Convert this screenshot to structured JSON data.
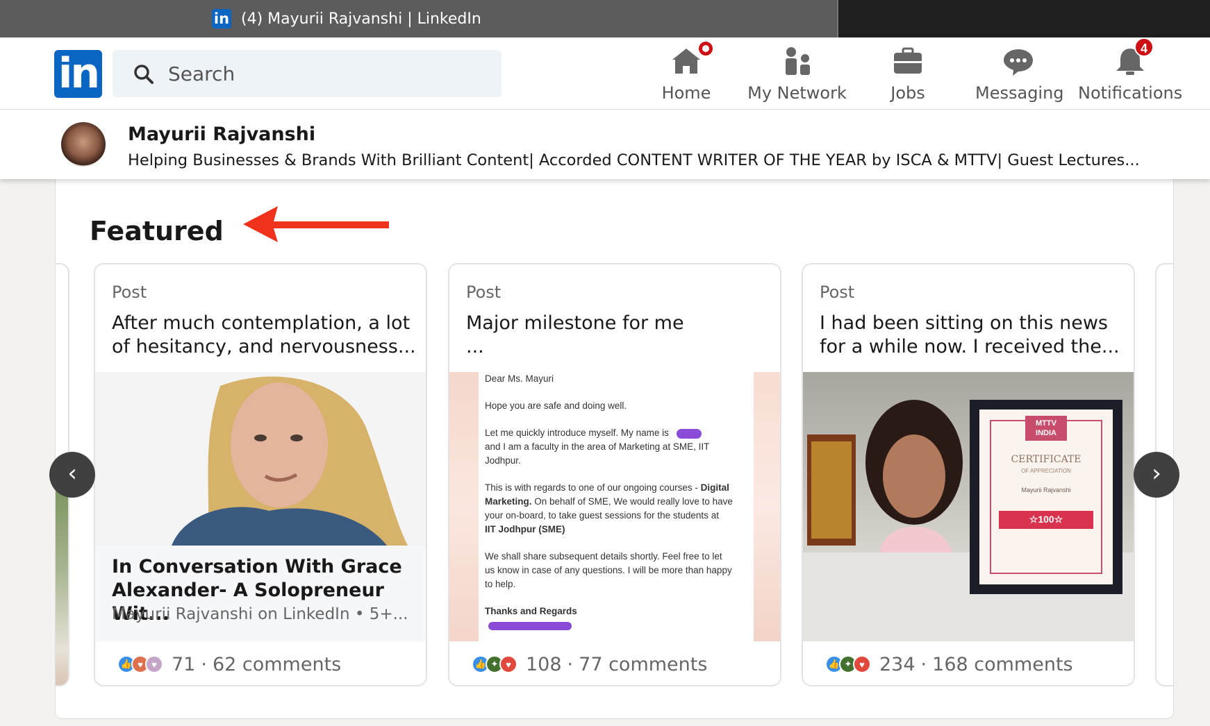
{
  "browser": {
    "tab_title": "(4) Mayurii Rajvanshi | LinkedIn",
    "favicon_text": "in"
  },
  "nav": {
    "logo_text": "in",
    "search_placeholder": "Search",
    "items": [
      {
        "label": "Home",
        "icon": "home-icon",
        "badge": ""
      },
      {
        "label": "My Network",
        "icon": "network-icon",
        "badge": ""
      },
      {
        "label": "Jobs",
        "icon": "briefcase-icon",
        "badge": ""
      },
      {
        "label": "Messaging",
        "icon": "chat-bubble-icon",
        "badge": ""
      },
      {
        "label": "Notifications",
        "icon": "bell-icon",
        "badge": "4"
      }
    ]
  },
  "profile": {
    "name": "Mayurii Rajvanshi",
    "headline": "Helping Businesses & Brands With Brilliant Content| Accorded CONTENT WRITER OF THE YEAR by ISCA & MTTV| Guest Lectures..."
  },
  "featured": {
    "title": "Featured",
    "items": [
      {
        "type": "Post",
        "text": "After much contemplation, a lot of hesitancy, and nervousness...",
        "article_title": "In Conversation With Grace Alexander- A Solopreneur Wit...",
        "article_sub": "Mayurii Rajvanshi on LinkedIn • 5+...",
        "reactions_count": "71",
        "comments": "62 comments"
      },
      {
        "type": "Post",
        "text": "Major milestone for me ...",
        "reactions_count": "108",
        "comments": "77 comments",
        "letter": {
          "greeting": "Dear Ms. Mayuri",
          "line1": "Hope you are safe and doing well.",
          "line2": "Let me quickly introduce myself. My name is",
          "line3": "and I am a faculty in the area of Marketing at SME, IIT",
          "line4": "Jodhpur.",
          "line5a": "This is with regards to one of our ongoing courses - ",
          "line5b": "Digital",
          "line6a": "Marketing.",
          "line6b": " On behalf of SME, We would really love to have",
          "line7": "your on-board, to take guest sessions for the students at",
          "line8": "IIT Jodhpur (SME)",
          "line9": "We shall share subsequent details shortly. Feel free to let",
          "line10": "us know in case of any questions. I will be more than happy",
          "line11": "to help.",
          "closing": "Thanks and Regards"
        }
      },
      {
        "type": "Post",
        "text": "I had been sitting on this news for a while now. I received the...",
        "reactions_count": "234",
        "comments": "168 comments",
        "certificate": {
          "logo": "MTTV INDIA",
          "heading": "CERTIFICATE",
          "sub": "OF APPRECIATION",
          "name": "Mayurii Rajvanshi",
          "award": "☆100☆"
        }
      }
    ],
    "prev_arrow": "‹",
    "next_arrow": "›"
  },
  "colors": {
    "brand": "#0a66c2",
    "badge": "#cc1016",
    "annotation_arrow": "#f0321d"
  }
}
